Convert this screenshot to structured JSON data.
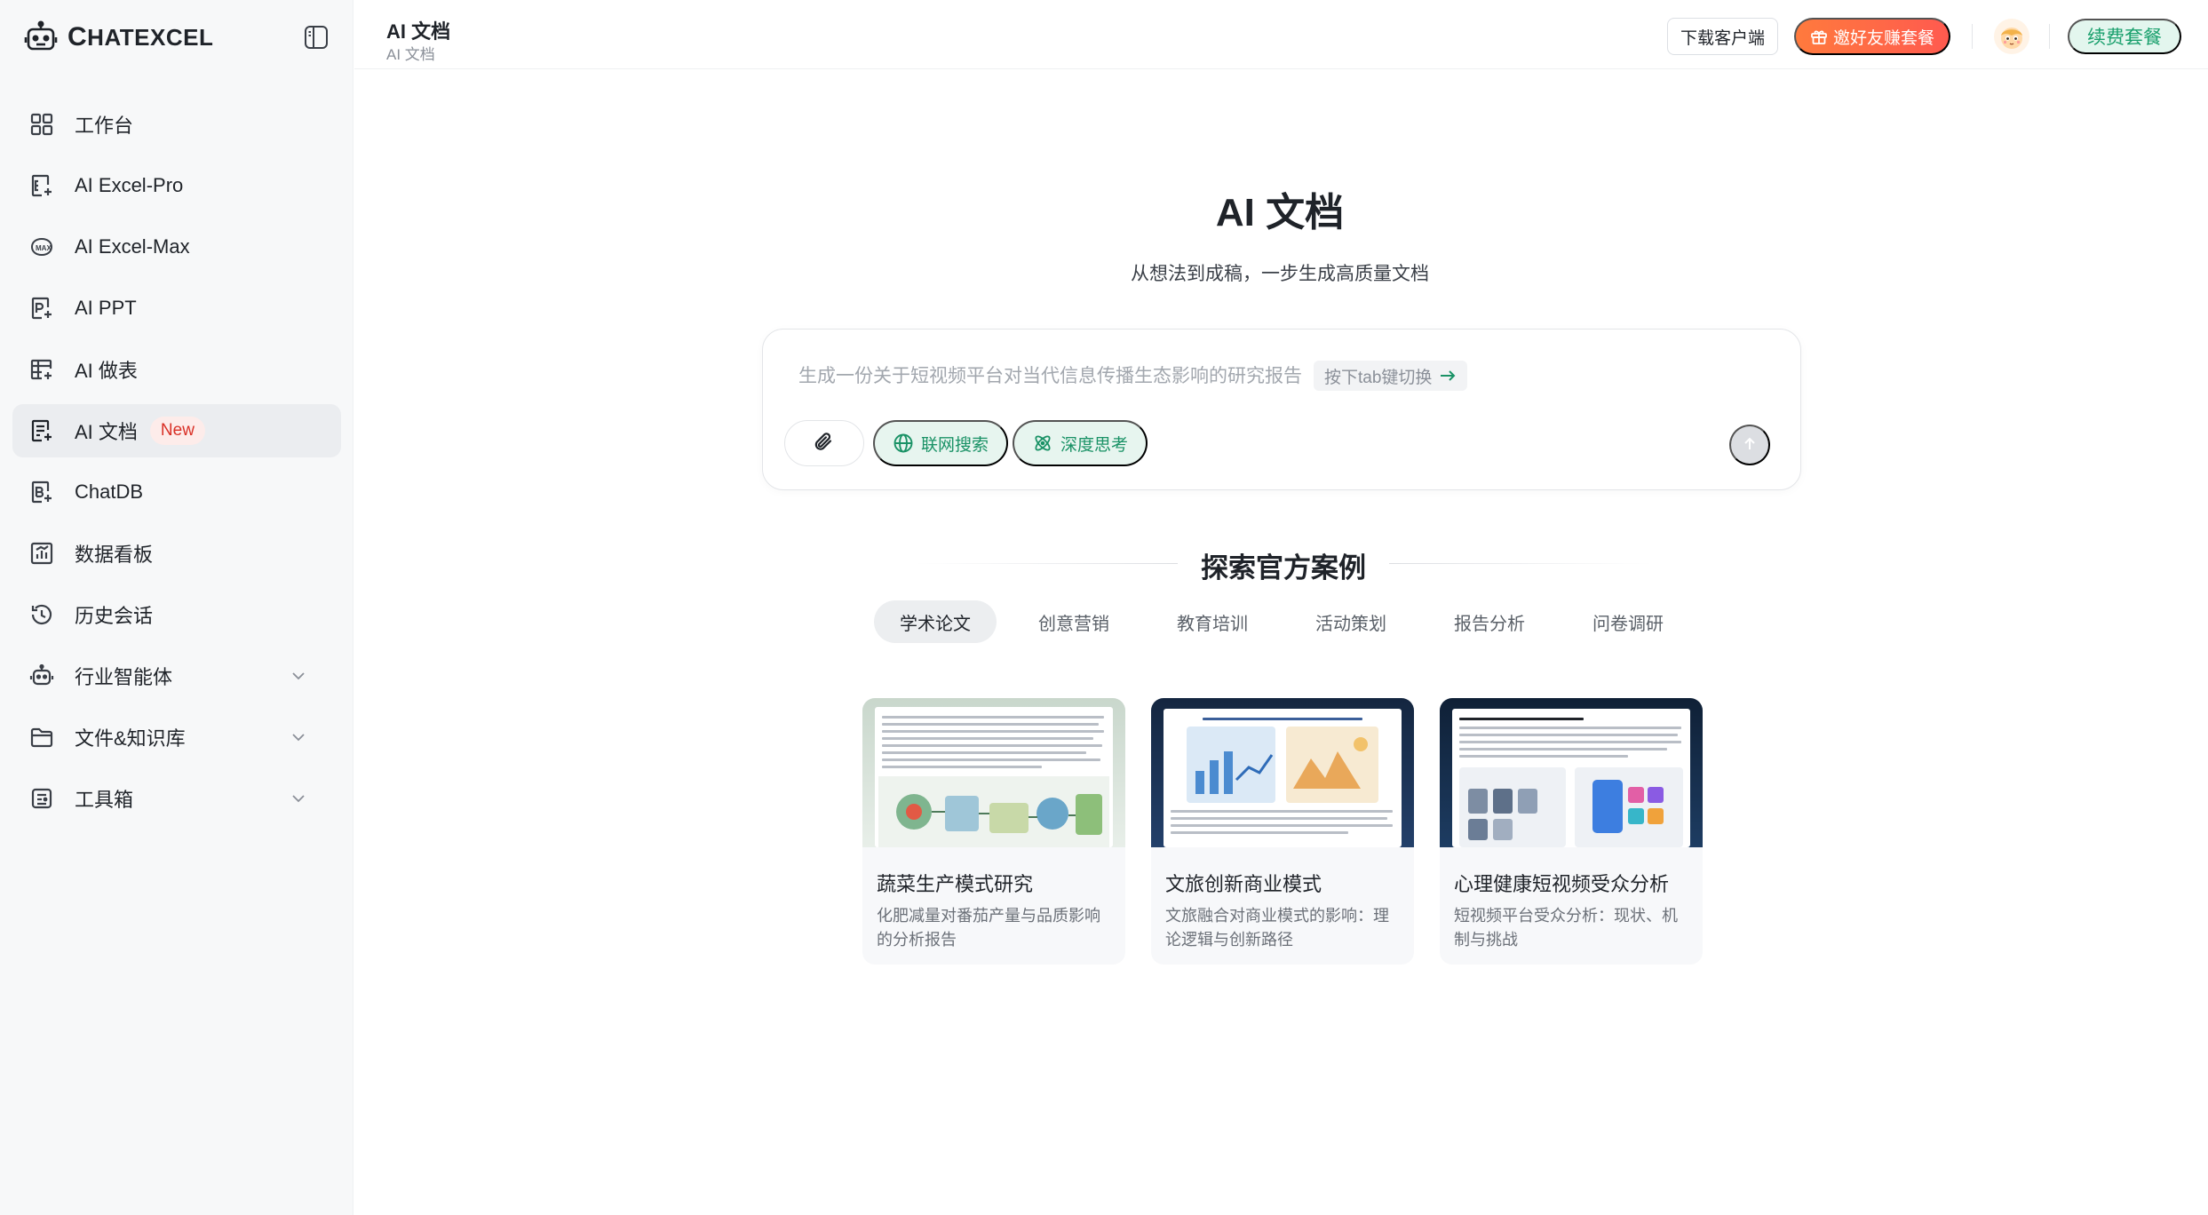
{
  "app": {
    "logo_text": "ChatExcel",
    "logo_first": "C",
    "logo_rest": "HATEXCEL"
  },
  "sidebar": {
    "items": [
      {
        "label": "工作台",
        "icon": "grid-icon"
      },
      {
        "label": "AI Excel-Pro",
        "icon": "excel-pro-icon"
      },
      {
        "label": "AI Excel-Max",
        "icon": "excel-max-icon"
      },
      {
        "label": "AI PPT",
        "icon": "ppt-icon"
      },
      {
        "label": "AI 做表",
        "icon": "table-icon"
      },
      {
        "label": "AI 文档",
        "icon": "doc-icon",
        "badge": "New",
        "active": true
      },
      {
        "label": "ChatDB",
        "icon": "chatdb-icon"
      },
      {
        "label": "数据看板",
        "icon": "dashboard-icon"
      },
      {
        "label": "历史会话",
        "icon": "history-icon"
      },
      {
        "label": "行业智能体",
        "icon": "robot-icon",
        "expandable": true
      },
      {
        "label": "文件&知识库",
        "icon": "folder-icon",
        "expandable": true
      },
      {
        "label": "工具箱",
        "icon": "toolbox-icon",
        "expandable": true
      }
    ]
  },
  "header": {
    "title": "AI 文档",
    "subtitle": "AI 文档",
    "download_label": "下载客户端",
    "invite_label": "邀好友赚套餐",
    "renew_label": "续费套餐"
  },
  "main": {
    "hero_title": "AI 文档",
    "hero_subtitle": "从想法到成稿，一步生成高质量文档",
    "prompt_placeholder": "生成一份关于短视频平台对当代信息传播生态影响的研究报告",
    "tab_hint": "按下tab键切换",
    "web_search_label": "联网搜索",
    "deep_think_label": "深度思考",
    "section_title": "探索官方案例",
    "tabs": [
      "学术论文",
      "创意营销",
      "教育培训",
      "活动策划",
      "报告分析",
      "问卷调研"
    ],
    "active_tab": 0,
    "cards": [
      {
        "title": "蔬菜生产模式研究",
        "desc": "化肥减量对番茄产量与品质影响的分析报告"
      },
      {
        "title": "文旅创新商业模式",
        "desc": "文旅融合对商业模式的影响：理论逻辑与创新路径"
      },
      {
        "title": "心理健康短视频受众分析",
        "desc": "短视频平台受众分析：现状、机制与挑战"
      }
    ]
  },
  "colors": {
    "accent_green": "#1aa06d",
    "invite_orange": "#ff6a45",
    "new_badge_red": "#d93026",
    "sidebar_bg": "#f7f8f9"
  }
}
